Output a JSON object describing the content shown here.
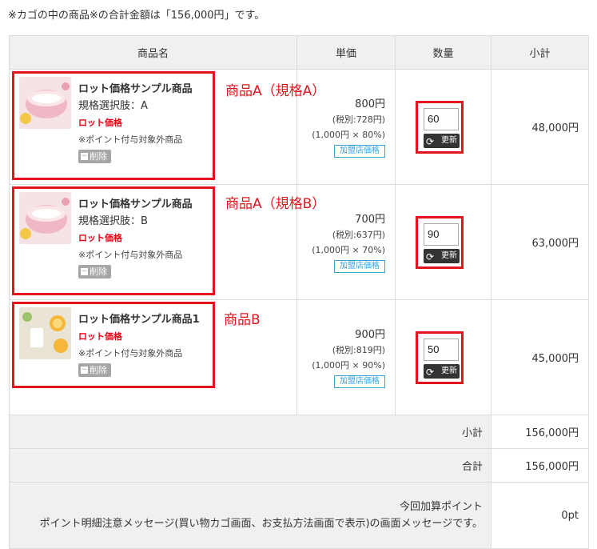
{
  "notice": "※カゴの中の商品※の合計金額は「156,000円」です。",
  "headers": {
    "product": "商品名",
    "unit_price": "単価",
    "quantity": "数量",
    "subtotal": "小計"
  },
  "items": [
    {
      "name": "ロット価格サンプル商品",
      "variant": "規格選択肢：A",
      "lot_label": "ロット価格",
      "point_note": "※ポイント付与対象外商品",
      "delete_label": "削除",
      "annotation": "商品A（規格A）",
      "price": "800円",
      "price_tax": "(税別:728円)",
      "price_calc": "(1,000円 × 80%)",
      "badge": "加盟店価格",
      "qty": "60",
      "update_label": "更新",
      "subtotal": "48,000円"
    },
    {
      "name": "ロット価格サンプル商品",
      "variant": "規格選択肢：B",
      "lot_label": "ロット価格",
      "point_note": "※ポイント付与対象外商品",
      "delete_label": "削除",
      "annotation": "商品A（規格B）",
      "price": "700円",
      "price_tax": "(税別:637円)",
      "price_calc": "(1,000円 × 70%)",
      "badge": "加盟店価格",
      "qty": "90",
      "update_label": "更新",
      "subtotal": "63,000円"
    },
    {
      "name": "ロット価格サンプル商品1",
      "variant": "",
      "lot_label": "ロット価格",
      "point_note": "※ポイント付与対象外商品",
      "delete_label": "削除",
      "annotation": "商品B",
      "price": "900円",
      "price_tax": "(税別:819円)",
      "price_calc": "(1,000円 × 90%)",
      "badge": "加盟店価格",
      "qty": "50",
      "update_label": "更新",
      "subtotal": "45,000円"
    }
  ],
  "summary": {
    "subtotal_label": "小計",
    "subtotal_value": "156,000円",
    "total_label": "合計",
    "total_value": "156,000円",
    "points_title": "今回加算ポイント",
    "points_message": "ポイント明細注意メッセージ(買い物カゴ画面、お支払方法画面で表示)の画面メッセージです。",
    "points_value": "0pt"
  },
  "colors": {
    "annotation": "#e3141e",
    "lot": "#e60012",
    "badge": "#3aa3d6"
  }
}
